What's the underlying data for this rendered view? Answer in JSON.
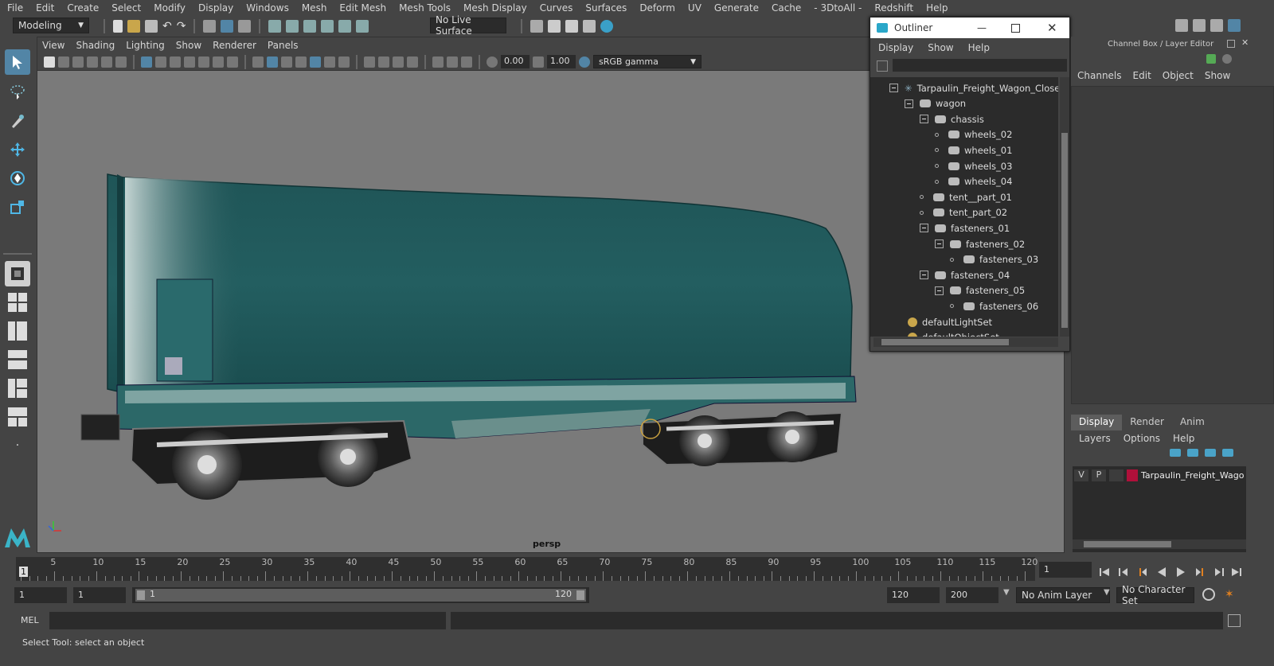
{
  "menu": [
    "File",
    "Edit",
    "Create",
    "Select",
    "Modify",
    "Display",
    "Windows",
    "Mesh",
    "Edit Mesh",
    "Mesh Tools",
    "Mesh Display",
    "Curves",
    "Surfaces",
    "Deform",
    "UV",
    "Generate",
    "Cache",
    "- 3DtoAll -",
    "Redshift",
    "Help"
  ],
  "status": {
    "mode": "Modeling",
    "live_surface": "No Live Surface"
  },
  "viewport": {
    "menu": [
      "View",
      "Shading",
      "Lighting",
      "Show",
      "Renderer",
      "Panels"
    ],
    "exposure": "0.00",
    "gamma": "1.00",
    "color_space": "sRGB gamma",
    "camera": "persp"
  },
  "outliner": {
    "title": "Outliner",
    "menu": [
      "Display",
      "Show",
      "Help"
    ],
    "items": [
      {
        "label": "Tarpaulin_Freight_Wagon_Closed_",
        "depth": 0,
        "kind": "root"
      },
      {
        "label": "wagon",
        "depth": 1,
        "kind": "group"
      },
      {
        "label": "chassis",
        "depth": 2,
        "kind": "group"
      },
      {
        "label": "wheels_02",
        "depth": 3,
        "kind": "leaf"
      },
      {
        "label": "wheels_01",
        "depth": 3,
        "kind": "leaf"
      },
      {
        "label": "wheels_03",
        "depth": 3,
        "kind": "leaf"
      },
      {
        "label": "wheels_04",
        "depth": 3,
        "kind": "leaf"
      },
      {
        "label": "tent__part_01",
        "depth": 2,
        "kind": "leaf"
      },
      {
        "label": "tent_part_02",
        "depth": 2,
        "kind": "leaf"
      },
      {
        "label": "fasteners_01",
        "depth": 2,
        "kind": "group"
      },
      {
        "label": "fasteners_02",
        "depth": 3,
        "kind": "group"
      },
      {
        "label": "fasteners_03",
        "depth": 4,
        "kind": "leaf"
      },
      {
        "label": "fasteners_04",
        "depth": 2,
        "kind": "group"
      },
      {
        "label": "fasteners_05",
        "depth": 3,
        "kind": "group"
      },
      {
        "label": "fasteners_06",
        "depth": 4,
        "kind": "leaf"
      },
      {
        "label": "defaultLightSet",
        "depth": 1,
        "kind": "set"
      },
      {
        "label": "defaultObjectSet",
        "depth": 1,
        "kind": "set"
      }
    ]
  },
  "channel_box": {
    "title": "Channel Box / Layer Editor",
    "menu": [
      "Channels",
      "Edit",
      "Object",
      "Show"
    ],
    "tabs": [
      "Display",
      "Render",
      "Anim"
    ],
    "layer_menu": [
      "Layers",
      "Options",
      "Help"
    ],
    "layer": {
      "v": "V",
      "p": "P",
      "name": "Tarpaulin_Freight_Wago",
      "color": "#b0103a"
    }
  },
  "timeline": {
    "ticks": [
      "5",
      "10",
      "15",
      "20",
      "25",
      "30",
      "35",
      "40",
      "45",
      "50",
      "55",
      "60",
      "65",
      "70",
      "75",
      "80",
      "85",
      "90",
      "95",
      "100",
      "105",
      "110",
      "115",
      "120"
    ],
    "current_marker": "1",
    "current_frame": "1"
  },
  "range": {
    "start": "1",
    "playback_start": "1",
    "slider_start": "1",
    "slider_end": "120",
    "playback_end": "120",
    "end": "200",
    "anim_layer": "No Anim Layer",
    "character_set": "No Character Set"
  },
  "command": {
    "label": "MEL"
  },
  "help_line": "Select Tool: select an object",
  "colors": {
    "accent": "#5285a6",
    "teal": "#1d5a5c"
  }
}
